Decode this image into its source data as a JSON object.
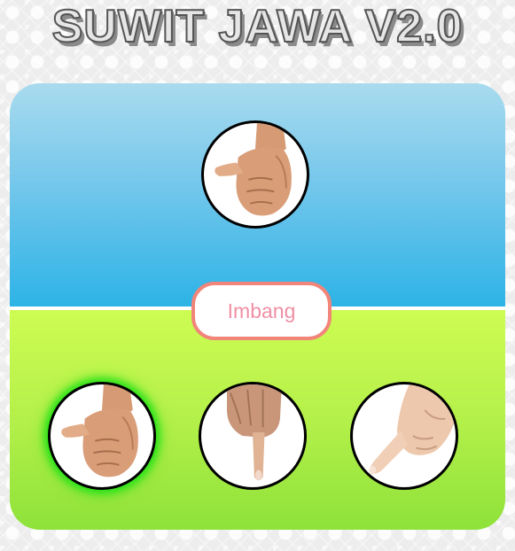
{
  "title": "SUWIT JAWA V2.0",
  "result_text": "Imbang",
  "opponent": {
    "choice_icon": "thumb-fist-icon"
  },
  "choices": [
    {
      "icon": "thumb-fist-icon",
      "selected": true
    },
    {
      "icon": "index-finger-down-icon",
      "selected": false
    },
    {
      "icon": "pinky-finger-icon",
      "selected": false
    }
  ],
  "colors": {
    "sky_top": "#a9dbee",
    "sky_bottom": "#2db3e6",
    "grass_top": "#cdfc52",
    "grass_bottom": "#8ee23a",
    "result_border": "#f2857a",
    "result_text": "#f08fa4",
    "selected_glow": "#2de21a"
  }
}
